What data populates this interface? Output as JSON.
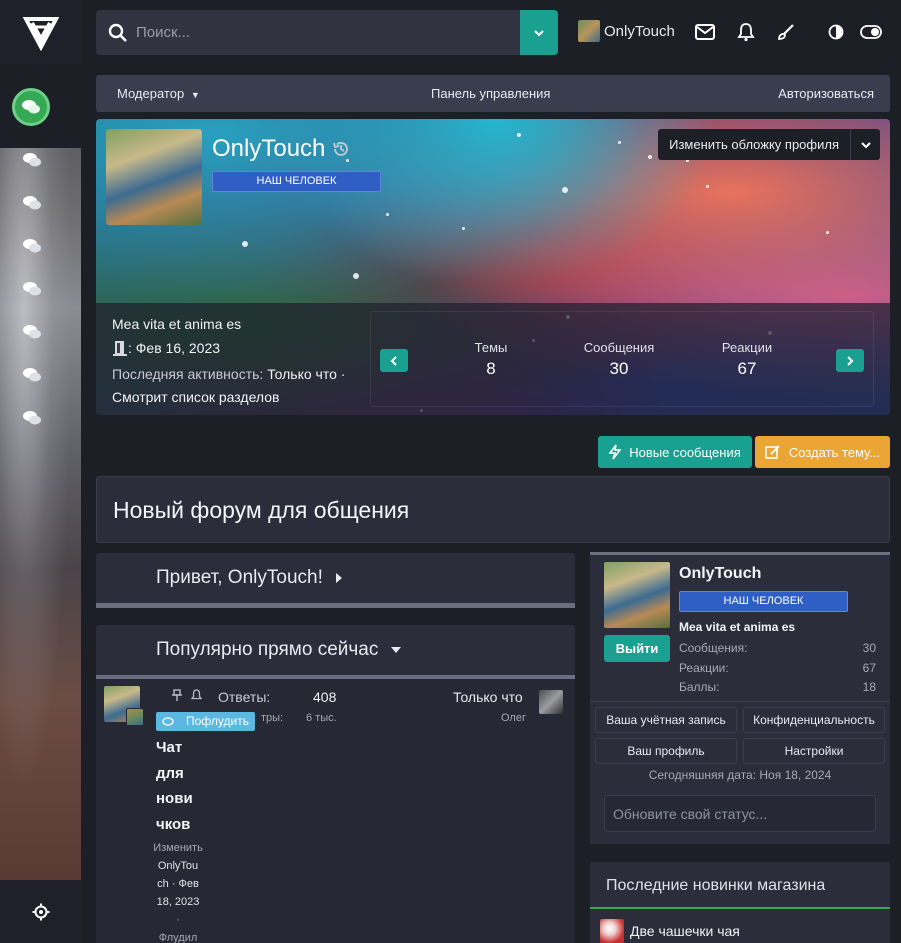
{
  "search": {
    "placeholder": "Поиск..."
  },
  "header": {
    "username": "OnlyTouch"
  },
  "nav": {
    "moderator": "Модератор",
    "control_panel": "Панель управления",
    "authorize": "Авторизоваться"
  },
  "profile": {
    "name": "OnlyTouch",
    "badge": "НАШ ЧЕЛОВЕК",
    "change_cover": "Изменить обложку профиля",
    "motto": "Mea vita et anima es",
    "joined": ": Фев 16, 2023",
    "last_activity_label": "Последняя активность:",
    "last_activity_value": "Только что",
    "status": "Смотрит список разделов",
    "stats": [
      {
        "label": "Темы",
        "value": "8"
      },
      {
        "label": "Сообщения",
        "value": "30"
      },
      {
        "label": "Реакции",
        "value": "67"
      }
    ]
  },
  "actions": {
    "new_posts": "Новые сообщения",
    "create_thread": "Создать тему..."
  },
  "forum_title": "Новый форум для общения",
  "blocks": {
    "greeting": "Привет, OnlyTouch!",
    "popular": "Популярно прямо сейчас"
  },
  "thread": {
    "prefix": "Пофлудить",
    "title": "Чат для нови чков",
    "title_lines": [
      "Чат",
      "для",
      "нови",
      "чков"
    ],
    "sub_lines": [
      "Изменить",
      "OnlyTou",
      "ch · Фев",
      "18, 2023",
      "·",
      "Флудил"
    ],
    "replies_label": "Ответы:",
    "replies_value": "408",
    "views_label": "тры:",
    "views_value": "6 тыс.",
    "last_time": "Только что",
    "last_user": "Олег"
  },
  "sidebar_user": {
    "name": "OnlyTouch",
    "badge": "НАШ ЧЕЛОВЕК",
    "logout": "Выйти",
    "motto": "Mea vita et anima es",
    "rows": [
      {
        "label": "Сообщения:",
        "value": "30"
      },
      {
        "label": "Реакции:",
        "value": "67"
      },
      {
        "label": "Баллы:",
        "value": "18"
      }
    ],
    "links": [
      "Ваша учётная запись",
      "Конфиденциальность",
      "Ваш профиль",
      "Настройки"
    ],
    "date": "Сегодняшняя дата: Ноя 18, 2024",
    "status_placeholder": "Обновите свой статус..."
  },
  "shop": {
    "title": "Последние новинки магазина",
    "item": "Две чашечки чая"
  },
  "colors": {
    "accent": "#1aa090",
    "warning": "#eaa534",
    "badge": "#2f5fc4",
    "online": "#34a853"
  }
}
